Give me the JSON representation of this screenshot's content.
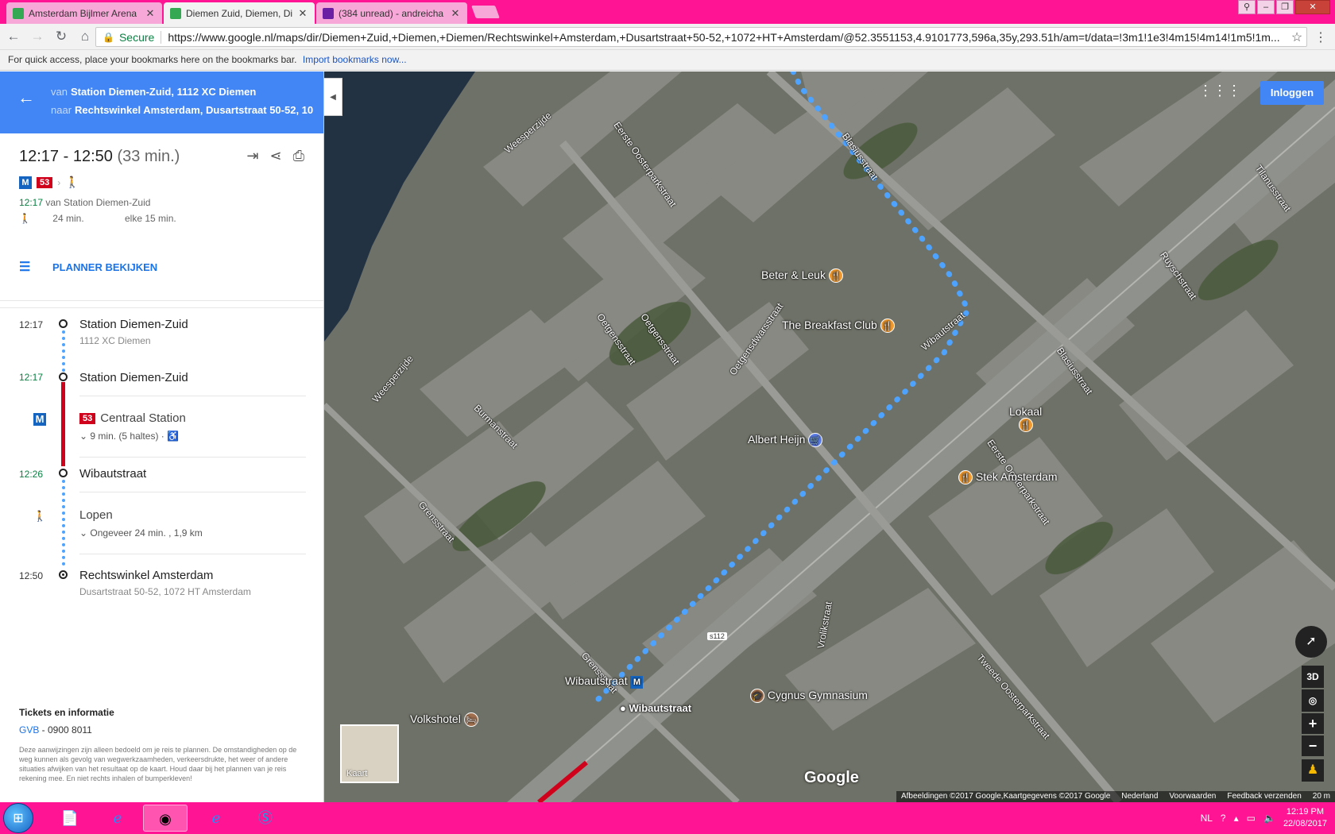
{
  "browser": {
    "tabs": [
      {
        "title": "Amsterdam Bijlmer Arena",
        "close": "✕"
      },
      {
        "title": "Diemen Zuid, Diemen, Di",
        "close": "✕"
      },
      {
        "title": "(384 unread) - andreicha",
        "close": "✕"
      }
    ],
    "secure_label": "Secure",
    "url": "https://www.google.nl/maps/dir/Diemen+Zuid,+Diemen,+Diemen/Rechtswinkel+Amsterdam,+Dusartstraat+50-52,+1072+HT+Amsterdam/@52.3551153,4.9101773,596a,35y,293.51h/am=t/data=!3m1!1e3!4m15!4m14!1m5!1m...",
    "bookmarks_text": "For quick access, place your bookmarks here on the bookmarks bar.",
    "bookmarks_link": "Import bookmarks now..."
  },
  "directions": {
    "from_label": "van",
    "from_value": "Station Diemen-Zuid, 1112 XC Diemen",
    "to_label": "naar",
    "to_value": "Rechtswinkel Amsterdam, Dusartstraat 50-52, 10...",
    "time_range": "12:17 - 12:50",
    "duration": "(33 min.)",
    "line_number": "53",
    "metro_letter": "M",
    "dep_time": "12:17",
    "dep_text": "van Station Diemen-Zuid",
    "walk_time": "24 min.",
    "frequency": "elke 15 min.",
    "planner_label": "PLANNER BEKIJKEN"
  },
  "plan": {
    "s1_time": "12:17",
    "s1_name": "Station Diemen-Zuid",
    "s1_sub": "1112 XC Diemen",
    "s2_time": "12:17",
    "s2_name": "Station Diemen-Zuid",
    "metro_dest": "Centraal Station",
    "metro_info": "9 min. (5 haltes) ·",
    "s3_time": "12:26",
    "s3_name": "Wibautstraat",
    "walk_title": "Lopen",
    "walk_info": "Ongeveer 24 min. , 1,9 km",
    "s4_time": "12:50",
    "s4_name": "Rechtswinkel Amsterdam",
    "s4_sub": "Dusartstraat 50-52, 1072 HT Amsterdam"
  },
  "tickets": {
    "title": "Tickets en informatie",
    "agency": "GVB",
    "phone": " - 0900 8011",
    "disclaimer": "Deze aanwijzingen zijn alleen bedoeld om je reis te plannen. De omstandigheden op de weg kunnen als gevolg van wegwerkzaamheden, verkeersdrukte, het weer of andere situaties afwijken van het resultaat op de kaart. Houd daar bij het plannen van je reis rekening mee. En niet rechts inhalen of bumperkleven!"
  },
  "map": {
    "signin": "Inloggen",
    "places": {
      "beter": "Beter & Leuk",
      "breakfast": "The Breakfast Club",
      "lokaal": "Lokaal",
      "albert": "Albert Heijn",
      "stek": "Stek Amsterdam",
      "cygnus": "Cygnus Gymnasium",
      "volkshotel": "Volkshotel",
      "wibaut_station": "Wibautstraat",
      "wibaut_stop": "Wibautstraat"
    },
    "streets": {
      "eerste1": "Eerste Oosterparkstraat",
      "blasius1": "Blasiusstraat",
      "weesperzijde1": "Weesperzijde",
      "weesperzijde2": "Weesperzijde",
      "oetgens1": "Oetgensstraat",
      "oetgens2": "Oetgensstraat",
      "oetgensdwars": "Oetgensdwarsstraat",
      "wibaut": "Wibautstraat",
      "burman": "Burmanstraat",
      "grens1": "Grensstraat",
      "grens2": "Grensstraat",
      "tilanus": "Tilanusstraat",
      "ruysch": "Ruyschstraat",
      "blasius2": "Blasiusstraat",
      "eerste2": "Eerste Oosterparkstraat",
      "vrolik": "Vrolikstraat",
      "tweede": "Tweede Oosterparkstraat",
      "s112": "s112"
    },
    "kaart": "Kaart",
    "btn_3d": "3D",
    "logo": "Google",
    "footer": [
      "Afbeeldingen ©2017 Google,Kaartgegevens ©2017 Google",
      "Nederland",
      "Voorwaarden",
      "Feedback verzenden",
      "20 m"
    ]
  },
  "taskbar": {
    "lang": "NL",
    "time": "12:19 PM",
    "date": "22/08/2017"
  }
}
